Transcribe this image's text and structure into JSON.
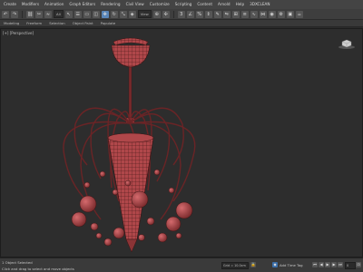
{
  "menubar": {
    "items": [
      "Create",
      "Modifiers",
      "Animation",
      "Graph Editors",
      "Rendering",
      "Civil View",
      "Customize",
      "Scripting",
      "Content",
      "Arnold",
      "Help",
      "3DXCLEAN"
    ]
  },
  "toolbar": {
    "selection_filter": "All",
    "view_dropdown": "View",
    "active_tool": "select-move"
  },
  "viewport": {
    "label": "[+] [Perspective]",
    "object_color": "#b0474a",
    "wire_color": "#3a1414",
    "background": "#2d2d2d"
  },
  "statusbar": {
    "selection_info": "1 Object Selected",
    "prompt": "Click and drag to select and move objects",
    "grid": "Grid = 10.0cm",
    "add_time_tag": "Add Time Tag",
    "frame_field": "0"
  },
  "colors": {
    "accent": "#5a86b8",
    "chrome_dark": "#2b2b2b",
    "chrome_mid": "#3e3e3e"
  }
}
